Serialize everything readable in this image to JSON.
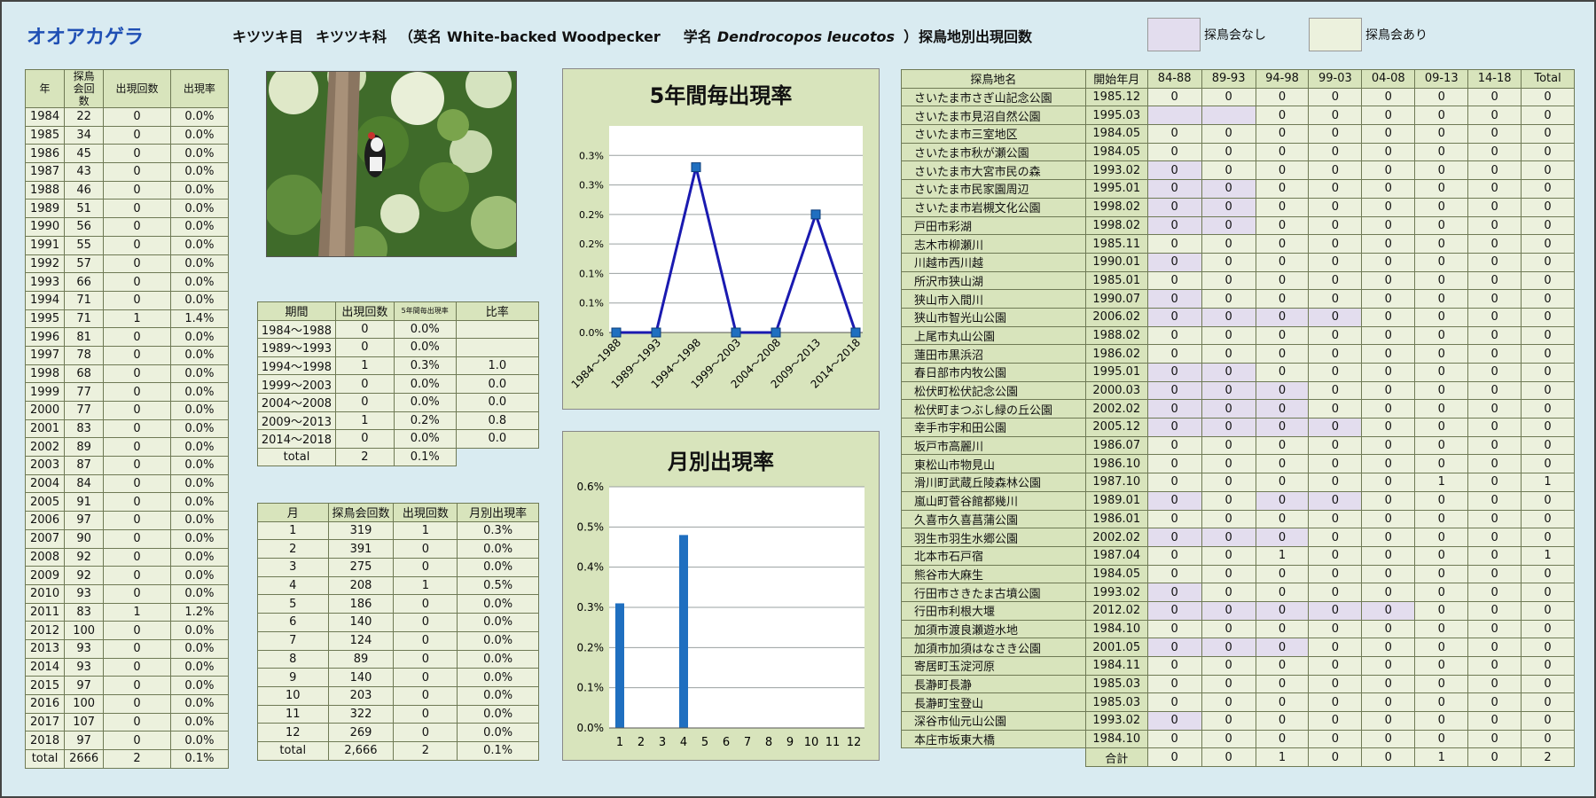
{
  "title": "オオアカゲラ",
  "header": {
    "order": "キツツキ目",
    "family": "キツツキ科",
    "open": "（英名",
    "english": "White-backed Woodpecker",
    "sci_label": "学名",
    "scientific": "Dendrocopos leucotos",
    "close": "）"
  },
  "section_title": "探鳥地別出現回数",
  "legend": [
    {
      "label": "探鳥会なし",
      "color": "#e3ddee"
    },
    {
      "label": "探鳥会あり",
      "color": "#ecf1dd"
    }
  ],
  "year_table": {
    "headers": [
      "年",
      "探鳥会回数",
      "出現回数",
      "出現率"
    ],
    "rows": [
      [
        "1984",
        "22",
        "0",
        "0.0%"
      ],
      [
        "1985",
        "34",
        "0",
        "0.0%"
      ],
      [
        "1986",
        "45",
        "0",
        "0.0%"
      ],
      [
        "1987",
        "43",
        "0",
        "0.0%"
      ],
      [
        "1988",
        "46",
        "0",
        "0.0%"
      ],
      [
        "1989",
        "51",
        "0",
        "0.0%"
      ],
      [
        "1990",
        "56",
        "0",
        "0.0%"
      ],
      [
        "1991",
        "55",
        "0",
        "0.0%"
      ],
      [
        "1992",
        "57",
        "0",
        "0.0%"
      ],
      [
        "1993",
        "66",
        "0",
        "0.0%"
      ],
      [
        "1994",
        "71",
        "0",
        "0.0%"
      ],
      [
        "1995",
        "71",
        "1",
        "1.4%"
      ],
      [
        "1996",
        "81",
        "0",
        "0.0%"
      ],
      [
        "1997",
        "78",
        "0",
        "0.0%"
      ],
      [
        "1998",
        "68",
        "0",
        "0.0%"
      ],
      [
        "1999",
        "77",
        "0",
        "0.0%"
      ],
      [
        "2000",
        "77",
        "0",
        "0.0%"
      ],
      [
        "2001",
        "83",
        "0",
        "0.0%"
      ],
      [
        "2002",
        "89",
        "0",
        "0.0%"
      ],
      [
        "2003",
        "87",
        "0",
        "0.0%"
      ],
      [
        "2004",
        "84",
        "0",
        "0.0%"
      ],
      [
        "2005",
        "91",
        "0",
        "0.0%"
      ],
      [
        "2006",
        "97",
        "0",
        "0.0%"
      ],
      [
        "2007",
        "90",
        "0",
        "0.0%"
      ],
      [
        "2008",
        "92",
        "0",
        "0.0%"
      ],
      [
        "2009",
        "92",
        "0",
        "0.0%"
      ],
      [
        "2010",
        "93",
        "0",
        "0.0%"
      ],
      [
        "2011",
        "83",
        "1",
        "1.2%"
      ],
      [
        "2012",
        "100",
        "0",
        "0.0%"
      ],
      [
        "2013",
        "93",
        "0",
        "0.0%"
      ],
      [
        "2014",
        "93",
        "0",
        "0.0%"
      ],
      [
        "2015",
        "97",
        "0",
        "0.0%"
      ],
      [
        "2016",
        "100",
        "0",
        "0.0%"
      ],
      [
        "2017",
        "107",
        "0",
        "0.0%"
      ],
      [
        "2018",
        "97",
        "0",
        "0.0%"
      ]
    ],
    "total": [
      "total",
      "2666",
      "2",
      "0.1%"
    ]
  },
  "period_table": {
    "headers": [
      "期間",
      "出現回数",
      "5年間毎出現率",
      "比率"
    ],
    "rows": [
      [
        "1984～1988",
        "0",
        "0.0%",
        ""
      ],
      [
        "1989～1993",
        "0",
        "0.0%",
        ""
      ],
      [
        "1994～1998",
        "1",
        "0.3%",
        "1.0"
      ],
      [
        "1999～2003",
        "0",
        "0.0%",
        "0.0"
      ],
      [
        "2004～2008",
        "0",
        "0.0%",
        "0.0"
      ],
      [
        "2009～2013",
        "1",
        "0.2%",
        "0.8"
      ],
      [
        "2014～2018",
        "0",
        "0.0%",
        "0.0"
      ]
    ],
    "total": [
      "total",
      "2",
      "0.1%"
    ]
  },
  "month_table": {
    "headers": [
      "月",
      "探鳥会回数",
      "出現回数",
      "月別出現率"
    ],
    "rows": [
      [
        "1",
        "319",
        "1",
        "0.3%"
      ],
      [
        "2",
        "391",
        "0",
        "0.0%"
      ],
      [
        "3",
        "275",
        "0",
        "0.0%"
      ],
      [
        "4",
        "208",
        "1",
        "0.5%"
      ],
      [
        "5",
        "186",
        "0",
        "0.0%"
      ],
      [
        "6",
        "140",
        "0",
        "0.0%"
      ],
      [
        "7",
        "124",
        "0",
        "0.0%"
      ],
      [
        "8",
        "89",
        "0",
        "0.0%"
      ],
      [
        "9",
        "140",
        "0",
        "0.0%"
      ],
      [
        "10",
        "203",
        "0",
        "0.0%"
      ],
      [
        "11",
        "322",
        "0",
        "0.0%"
      ],
      [
        "12",
        "269",
        "0",
        "0.0%"
      ]
    ],
    "total": [
      "total",
      "2,666",
      "2",
      "0.1%"
    ]
  },
  "site_table": {
    "headers": [
      "探鳥地名",
      "開始年月",
      "84-88",
      "89-93",
      "94-98",
      "99-03",
      "04-08",
      "09-13",
      "14-18",
      "Total"
    ],
    "rows": [
      {
        "name": "さいたま市さぎ山記念公園",
        "start": "1985.12",
        "v": [
          "0",
          "0",
          "0",
          "0",
          "0",
          "0",
          "0",
          "0"
        ],
        "none": []
      },
      {
        "name": "さいたま市見沼自然公園",
        "start": "1995.03",
        "v": [
          "",
          "",
          "0",
          "0",
          "0",
          "0",
          "0",
          "0"
        ],
        "none": [
          0,
          1
        ]
      },
      {
        "name": "さいたま市三室地区",
        "start": "1984.05",
        "v": [
          "0",
          "0",
          "0",
          "0",
          "0",
          "0",
          "0",
          "0"
        ],
        "none": []
      },
      {
        "name": "さいたま市秋が瀬公園",
        "start": "1984.05",
        "v": [
          "0",
          "0",
          "0",
          "0",
          "0",
          "0",
          "0",
          "0"
        ],
        "none": []
      },
      {
        "name": "さいたま市大宮市民の森",
        "start": "1993.02",
        "v": [
          "0",
          "0",
          "0",
          "0",
          "0",
          "0",
          "0",
          "0"
        ],
        "none": [
          0
        ]
      },
      {
        "name": "さいたま市民家園周辺",
        "start": "1995.01",
        "v": [
          "0",
          "0",
          "0",
          "0",
          "0",
          "0",
          "0",
          "0"
        ],
        "none": [
          0,
          1
        ]
      },
      {
        "name": "さいたま市岩槻文化公園",
        "start": "1998.02",
        "v": [
          "0",
          "0",
          "0",
          "0",
          "0",
          "0",
          "0",
          "0"
        ],
        "none": [
          0,
          1
        ]
      },
      {
        "name": "戸田市彩湖",
        "start": "1998.02",
        "v": [
          "0",
          "0",
          "0",
          "0",
          "0",
          "0",
          "0",
          "0"
        ],
        "none": [
          0,
          1
        ]
      },
      {
        "name": "志木市柳瀬川",
        "start": "1985.11",
        "v": [
          "0",
          "0",
          "0",
          "0",
          "0",
          "0",
          "0",
          "0"
        ],
        "none": []
      },
      {
        "name": "川越市西川越",
        "start": "1990.01",
        "v": [
          "0",
          "0",
          "0",
          "0",
          "0",
          "0",
          "0",
          "0"
        ],
        "none": [
          0
        ]
      },
      {
        "name": "所沢市狭山湖",
        "start": "1985.01",
        "v": [
          "0",
          "0",
          "0",
          "0",
          "0",
          "0",
          "0",
          "0"
        ],
        "none": []
      },
      {
        "name": "狭山市入間川",
        "start": "1990.07",
        "v": [
          "0",
          "0",
          "0",
          "0",
          "0",
          "0",
          "0",
          "0"
        ],
        "none": [
          0
        ]
      },
      {
        "name": "狭山市智光山公園",
        "start": "2006.02",
        "v": [
          "0",
          "0",
          "0",
          "0",
          "0",
          "0",
          "0",
          "0"
        ],
        "none": [
          0,
          1,
          2,
          3
        ]
      },
      {
        "name": "上尾市丸山公園",
        "start": "1988.02",
        "v": [
          "0",
          "0",
          "0",
          "0",
          "0",
          "0",
          "0",
          "0"
        ],
        "none": []
      },
      {
        "name": "蓮田市黒浜沼",
        "start": "1986.02",
        "v": [
          "0",
          "0",
          "0",
          "0",
          "0",
          "0",
          "0",
          "0"
        ],
        "none": []
      },
      {
        "name": "春日部市内牧公園",
        "start": "1995.01",
        "v": [
          "0",
          "0",
          "0",
          "0",
          "0",
          "0",
          "0",
          "0"
        ],
        "none": [
          0,
          1
        ]
      },
      {
        "name": "松伏町松伏記念公園",
        "start": "2000.03",
        "v": [
          "0",
          "0",
          "0",
          "0",
          "0",
          "0",
          "0",
          "0"
        ],
        "none": [
          0,
          1,
          2
        ]
      },
      {
        "name": "松伏町まつぶし緑の丘公園",
        "start": "2002.02",
        "v": [
          "0",
          "0",
          "0",
          "0",
          "0",
          "0",
          "0",
          "0"
        ],
        "none": [
          0,
          1,
          2
        ]
      },
      {
        "name": "幸手市宇和田公園",
        "start": "2005.12",
        "v": [
          "0",
          "0",
          "0",
          "0",
          "0",
          "0",
          "0",
          "0"
        ],
        "none": [
          0,
          1,
          2,
          3
        ]
      },
      {
        "name": "坂戸市高麗川",
        "start": "1986.07",
        "v": [
          "0",
          "0",
          "0",
          "0",
          "0",
          "0",
          "0",
          "0"
        ],
        "none": []
      },
      {
        "name": "東松山市物見山",
        "start": "1986.10",
        "v": [
          "0",
          "0",
          "0",
          "0",
          "0",
          "0",
          "0",
          "0"
        ],
        "none": []
      },
      {
        "name": "滑川町武蔵丘陵森林公園",
        "start": "1987.10",
        "v": [
          "0",
          "0",
          "0",
          "0",
          "0",
          "1",
          "0",
          "1"
        ],
        "none": []
      },
      {
        "name": "嵐山町菅谷館都幾川",
        "start": "1989.01",
        "v": [
          "0",
          "0",
          "0",
          "0",
          "0",
          "0",
          "0",
          "0"
        ],
        "none": [
          0,
          2,
          3
        ]
      },
      {
        "name": "久喜市久喜菖蒲公園",
        "start": "1986.01",
        "v": [
          "0",
          "0",
          "0",
          "0",
          "0",
          "0",
          "0",
          "0"
        ],
        "none": []
      },
      {
        "name": "羽生市羽生水郷公園",
        "start": "2002.02",
        "v": [
          "0",
          "0",
          "0",
          "0",
          "0",
          "0",
          "0",
          "0"
        ],
        "none": [
          0,
          1,
          2
        ]
      },
      {
        "name": "北本市石戸宿",
        "start": "1987.04",
        "v": [
          "0",
          "0",
          "1",
          "0",
          "0",
          "0",
          "0",
          "1"
        ],
        "none": []
      },
      {
        "name": "熊谷市大麻生",
        "start": "1984.05",
        "v": [
          "0",
          "0",
          "0",
          "0",
          "0",
          "0",
          "0",
          "0"
        ],
        "none": []
      },
      {
        "name": "行田市さきたま古墳公園",
        "start": "1993.02",
        "v": [
          "0",
          "0",
          "0",
          "0",
          "0",
          "0",
          "0",
          "0"
        ],
        "none": [
          0
        ]
      },
      {
        "name": "行田市利根大堰",
        "start": "2012.02",
        "v": [
          "0",
          "0",
          "0",
          "0",
          "0",
          "0",
          "0",
          "0"
        ],
        "none": [
          0,
          1,
          2,
          3,
          4
        ]
      },
      {
        "name": "加須市渡良瀬遊水地",
        "start": "1984.10",
        "v": [
          "0",
          "0",
          "0",
          "0",
          "0",
          "0",
          "0",
          "0"
        ],
        "none": []
      },
      {
        "name": "加須市加須はなさき公園",
        "start": "2001.05",
        "v": [
          "0",
          "0",
          "0",
          "0",
          "0",
          "0",
          "0",
          "0"
        ],
        "none": [
          0,
          1,
          2
        ]
      },
      {
        "name": "寄居町玉淀河原",
        "start": "1984.11",
        "v": [
          "0",
          "0",
          "0",
          "0",
          "0",
          "0",
          "0",
          "0"
        ],
        "none": []
      },
      {
        "name": "長瀞町長瀞",
        "start": "1985.03",
        "v": [
          "0",
          "0",
          "0",
          "0",
          "0",
          "0",
          "0",
          "0"
        ],
        "none": []
      },
      {
        "name": "長瀞町宝登山",
        "start": "1985.03",
        "v": [
          "0",
          "0",
          "0",
          "0",
          "0",
          "0",
          "0",
          "0"
        ],
        "none": []
      },
      {
        "name": "深谷市仙元山公園",
        "start": "1993.02",
        "v": [
          "0",
          "0",
          "0",
          "0",
          "0",
          "0",
          "0",
          "0"
        ],
        "none": [
          0
        ]
      },
      {
        "name": "本庄市坂東大橋",
        "start": "1984.10",
        "v": [
          "0",
          "0",
          "0",
          "0",
          "0",
          "0",
          "0",
          "0"
        ],
        "none": []
      }
    ],
    "total_label": "合計",
    "total": [
      "0",
      "0",
      "1",
      "0",
      "0",
      "1",
      "0",
      "2"
    ]
  },
  "chart_data": [
    {
      "type": "line",
      "title": "5年間毎出現率",
      "categories": [
        "1984～1988",
        "1989～1993",
        "1994～1998",
        "1999～2003",
        "2004～2008",
        "2009～2013",
        "2014～2018"
      ],
      "values": [
        0.0,
        0.0,
        0.28,
        0.0,
        0.0,
        0.2,
        0.0
      ],
      "ylim": [
        0,
        0.35
      ],
      "ytick_values": [
        0,
        0.05,
        0.1,
        0.15,
        0.2,
        0.25,
        0.3
      ],
      "ytick_labels": [
        "0.0%",
        "0.1%",
        "0.1%",
        "0.2%",
        "0.2%",
        "0.3%",
        "0.3%"
      ],
      "color": "#1a1ab0",
      "marker_color": "#1f6fc0",
      "grid": true
    },
    {
      "type": "bar",
      "title": "月別出現率",
      "categories": [
        "1",
        "2",
        "3",
        "4",
        "5",
        "6",
        "7",
        "8",
        "9",
        "10",
        "11",
        "12"
      ],
      "values": [
        0.31,
        0,
        0,
        0.48,
        0,
        0,
        0,
        0,
        0,
        0,
        0,
        0
      ],
      "ylim": [
        0,
        0.6
      ],
      "ytick_values": [
        0,
        0.1,
        0.2,
        0.3,
        0.4,
        0.5,
        0.6
      ],
      "ytick_labels": [
        "0.0%",
        "0.1%",
        "0.2%",
        "0.3%",
        "0.4%",
        "0.5%",
        "0.6%"
      ],
      "color": "#1f6fc0",
      "grid": true
    }
  ]
}
